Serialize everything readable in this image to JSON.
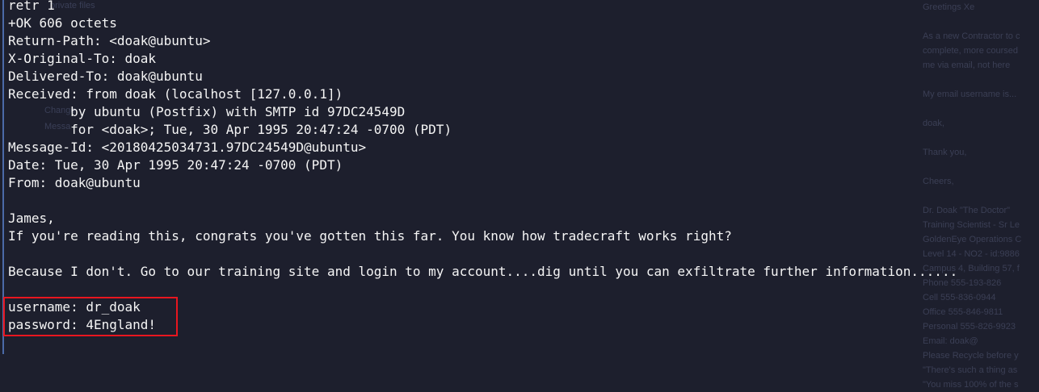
{
  "background_text_left": [
    "private files",
    "Change",
    "Messa"
  ],
  "background_text_right": [
    "Greetings Xe",
    "",
    "As a new Contractor to c",
    "complete, more coursed",
    "me via email, not here",
    "",
    "My email username is...",
    "",
    "doak,",
    "",
    "Thank you,",
    "",
    "Cheers,",
    "",
    "Dr. Doak \"The Doctor\"",
    "Training Scientist - Sr Le",
    "GoldenEye Operations C",
    "Level 14 - NO2 - id:9886",
    "Campus 4, Building 57, f",
    "Phone 555-193-826",
    "Cell 555-836-0944",
    "Office 555-846-9811",
    "Personal 555-826-9923",
    "Email: doak@",
    "Please Recycle before y",
    "\"There's such a thing as",
    "\"You miss 100% of the s"
  ],
  "terminal": {
    "lines": [
      "retr 1",
      "+OK 606 octets",
      "Return-Path: <doak@ubuntu>",
      "X-Original-To: doak",
      "Delivered-To: doak@ubuntu",
      "Received: from doak (localhost [127.0.0.1])",
      "        by ubuntu (Postfix) with SMTP id 97DC24549D",
      "        for <doak>; Tue, 30 Apr 1995 20:47:24 -0700 (PDT)",
      "Message-Id: <20180425034731.97DC24549D@ubuntu>",
      "Date: Tue, 30 Apr 1995 20:47:24 -0700 (PDT)",
      "From: doak@ubuntu",
      "",
      "James,",
      "If you're reading this, congrats you've gotten this far. You know how tradecraft works right?",
      "",
      "Because I don't. Go to our training site and login to my account....dig until you can exfiltrate further information......",
      "",
      "username: dr_doak",
      "password: 4England!"
    ]
  },
  "colors": {
    "background": "#1d1f2d",
    "text": "#f5f5f5",
    "highlight_border": "#e8161f",
    "left_border": "#4b6aa8"
  }
}
